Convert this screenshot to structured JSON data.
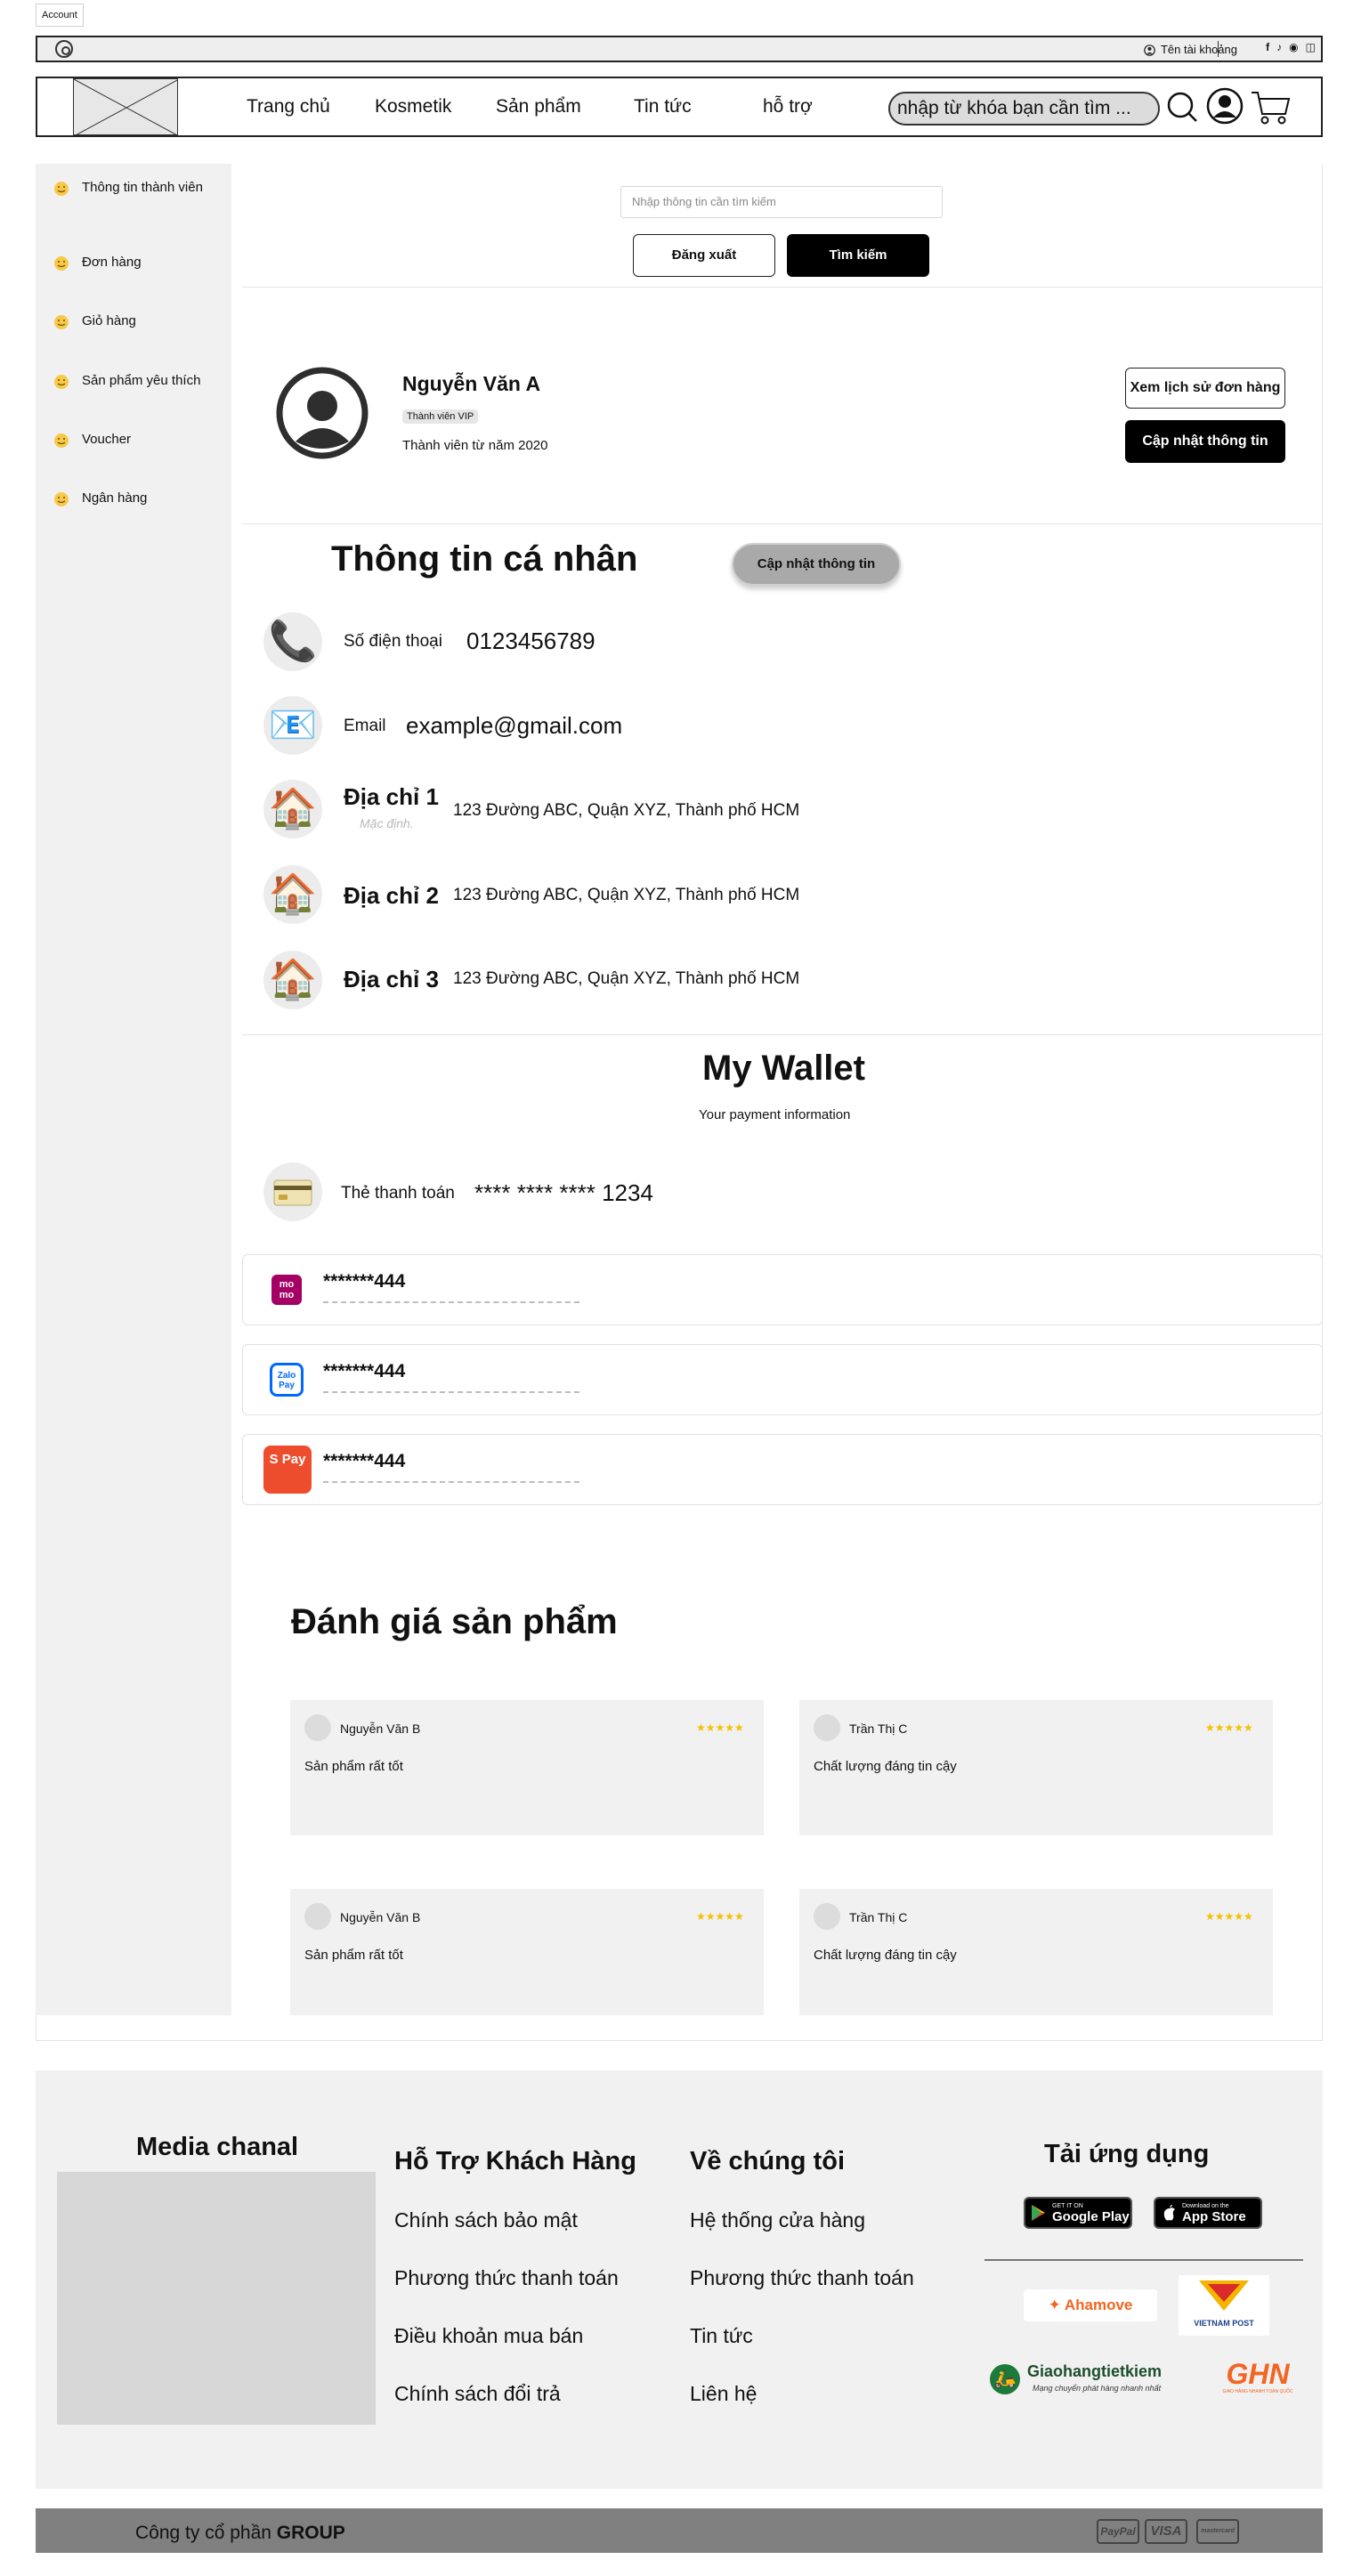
{
  "window": {
    "tab_label": "Account"
  },
  "topbar": {
    "account_label": "Tên tài khoảng",
    "social_icons": [
      "facebook-icon",
      "tiktok-icon",
      "youtube-icon",
      "instagram-icon"
    ]
  },
  "header": {
    "nav": [
      "Trang chủ",
      "Kosmetik",
      "Sản phẩm",
      "Tin tức",
      "hỗ trợ"
    ],
    "search_placeholder": "nhập từ khóa bạn cần tìm ..."
  },
  "sidebar": {
    "items": [
      {
        "label": "Thông tin thành viên",
        "icon": "smile-icon"
      },
      {
        "label": "Đơn hàng",
        "icon": "smile-icon"
      },
      {
        "label": "Giỏ hàng",
        "icon": "smile-icon"
      },
      {
        "label": "Sản phẩm yêu thích",
        "icon": "smile-icon"
      },
      {
        "label": "Voucher",
        "icon": "smile-icon"
      },
      {
        "label": "Ngân hàng",
        "icon": "smile-icon"
      }
    ]
  },
  "top_actions": {
    "search_placeholder": "Nhập thông tin cần tìm kiếm",
    "logout_label": "Đăng xuất",
    "search_label": "Tìm kiếm"
  },
  "profile": {
    "name": "Nguyễn Văn A",
    "badge": "Thành viên VIP",
    "since": "Thành viên từ năm 2020",
    "history_button": "Xem lịch sử đơn hàng",
    "update_button": "Cập nhật thông tin"
  },
  "personal": {
    "title": "Thông tin cá nhân",
    "update_button": "Cập nhật thông tin",
    "phone_label": "Số điện thoại",
    "phone_value": "0123456789",
    "email_label": "Email",
    "email_value": "example@gmail.com",
    "addresses": [
      {
        "title": "Địa chỉ 1",
        "value": "123 Đường ABC, Quận XYZ, Thành phố HCM",
        "sub": "Mặc định."
      },
      {
        "title": "Địa chỉ 2",
        "value": "123 Đường ABC, Quận XYZ, Thành phố HCM"
      },
      {
        "title": "Địa chỉ 3",
        "value": "123 Đường ABC, Quận XYZ, Thành phố HCM"
      }
    ]
  },
  "wallet": {
    "title": "My Wallet",
    "subtitle": "Your payment information",
    "card_label": "Thẻ thanh toán",
    "card_number": "**** **** **** 1234",
    "methods": [
      {
        "logo": "mo mo",
        "brand": "momo",
        "color": "#a50064",
        "number": "*******444"
      },
      {
        "logo": "Zalo Pay",
        "brand": "zalopay",
        "color": "#0068ff",
        "number": "*******444"
      },
      {
        "logo": "S Pay",
        "brand": "shopeepay",
        "color": "#ee4d2d",
        "number": "*******444"
      }
    ]
  },
  "reviews": {
    "title": "Đánh giá sản phẩm",
    "stars": "★★★★★",
    "items": [
      {
        "name": "Nguyễn Văn B",
        "text": "Sản phẩm rất tốt"
      },
      {
        "name": "Trần Thị C",
        "text": "Chất lượng đáng tin cậy"
      },
      {
        "name": "Nguyễn Văn B",
        "text": "Sản phẩm rất tốt"
      },
      {
        "name": "Trần Thị C",
        "text": "Chất lượng đáng tin cậy"
      }
    ]
  },
  "footer": {
    "media_title": "Media chanal",
    "support_title": "Hỗ Trợ Khách Hàng",
    "support_links": [
      "Chính sách bảo mật",
      "Phương thức thanh toán",
      "Điều khoản mua bán",
      "Chính sách đổi trả"
    ],
    "about_title": "Về chúng tôi",
    "about_links": [
      "Hệ thống cửa hàng",
      "Phương thức thanh toán",
      "Tin tức",
      "Liên hệ"
    ],
    "app_title": "Tải ứng dụng",
    "google_play": {
      "small": "GET IT ON",
      "big": "Google Play"
    },
    "app_store": {
      "small": "Download on the",
      "big": "App Store"
    },
    "shipping": {
      "ahamove": "Ahamove",
      "vietnam_post": "VIETNAM POST",
      "ghtk": "Giaohangtietkiem",
      "ghtk_sub": "Mạng chuyển phát hàng nhanh nhất",
      "ghn": "GHN",
      "ghn_sub": "GIAO HÀNG NHANH TOÀN QUỐC"
    },
    "copyright_prefix": "Công ty cổ phần ",
    "copyright_brand": "GROUP",
    "payment_marks": [
      "PayPal",
      "VISA",
      "mastercard"
    ]
  }
}
